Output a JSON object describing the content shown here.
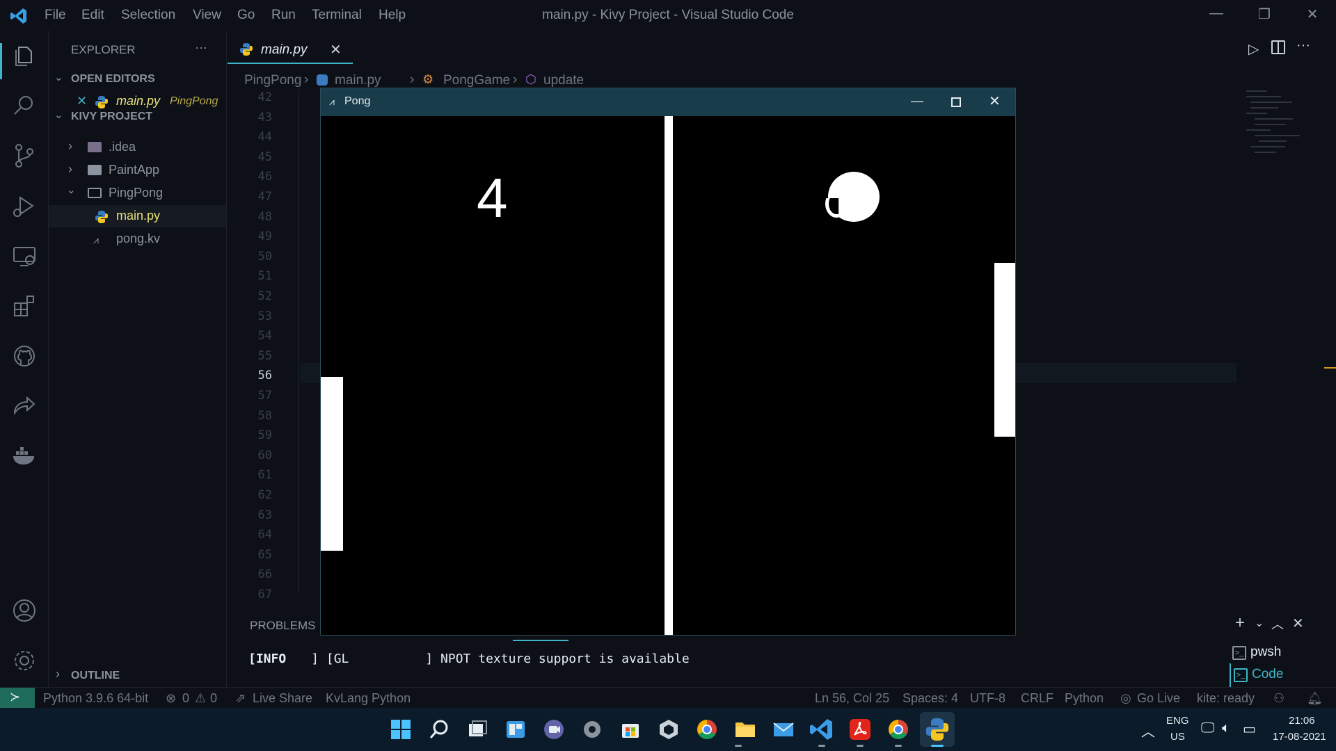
{
  "titlebar": {
    "menu": [
      "File",
      "Edit",
      "Selection",
      "View",
      "Go",
      "Run",
      "Terminal",
      "Help"
    ],
    "title": "main.py - Kivy Project - Visual Studio Code"
  },
  "explorer": {
    "header": "EXPLORER",
    "more": "···",
    "open_editors_label": "OPEN EDITORS",
    "open_editor": {
      "name": "main.py",
      "folder": "PingPong"
    },
    "project_label": "KIVY PROJECT",
    "tree": [
      {
        "name": ".idea"
      },
      {
        "name": "PaintApp"
      },
      {
        "name": "PingPong"
      },
      {
        "name": "main.py"
      },
      {
        "name": "pong.kv"
      }
    ],
    "outline_label": "OUTLINE"
  },
  "editor": {
    "tab": "main.py",
    "breadcrumb": [
      "PingPong",
      "main.py",
      "PongGame",
      "update"
    ],
    "line_numbers": [
      "42",
      "43",
      "44",
      "45",
      "46",
      "47",
      "48",
      "49",
      "50",
      "51",
      "52",
      "53",
      "54",
      "55",
      "56",
      "57",
      "58",
      "59",
      "60",
      "61",
      "62",
      "63",
      "64",
      "65",
      "66",
      "67"
    ],
    "current_line": "56"
  },
  "panel": {
    "problems_label": "PROBLEMS",
    "terminal_line": {
      "level": "[INFO",
      "sep": "] [GL",
      "msg": "] NPOT texture support is available"
    },
    "terminals": [
      "pwsh",
      "Code"
    ]
  },
  "statusbar": {
    "python": "Python 3.9.6 64-bit",
    "errors": "0",
    "warnings": "0",
    "live_share": "Live Share",
    "kvlang": "KvLang Python",
    "position": "Ln 56, Col 25",
    "spaces": "Spaces: 4",
    "encoding": "UTF-8",
    "eol": "CRLF",
    "language": "Python",
    "go_live": "Go Live",
    "kite": "kite: ready"
  },
  "pong": {
    "title": "Pong",
    "score_left": "4",
    "left_paddle_center": 0.67,
    "right_paddle_center": 0.45
  },
  "taskbar": {
    "lang_top": "ENG",
    "lang_bottom": "US",
    "time": "21:06",
    "date": "17-08-2021"
  },
  "colors": {
    "background": "#0d1117",
    "taskbar": "#0b1b2a",
    "pong_titlebar": "#183c4a",
    "accent": "#3fb6c8"
  }
}
